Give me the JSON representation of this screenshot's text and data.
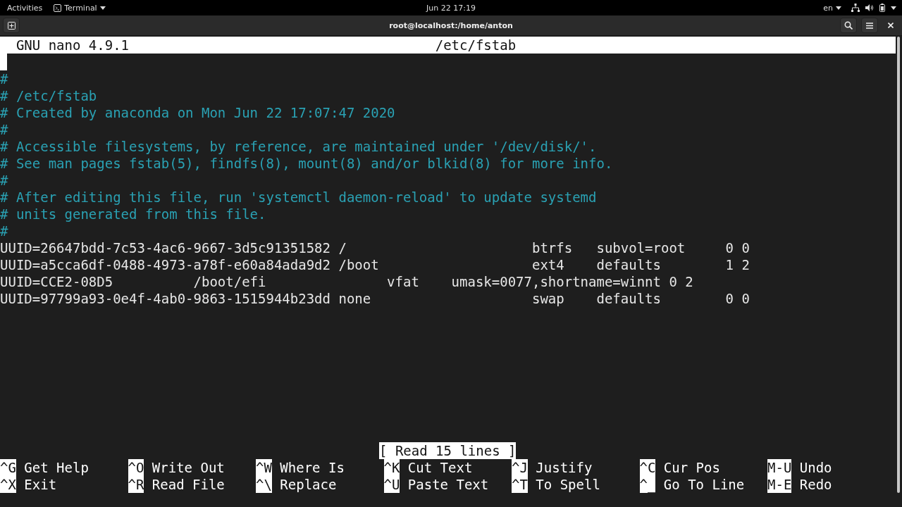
{
  "top_bar": {
    "activities": "Activities",
    "app_menu": {
      "label": "Terminal"
    },
    "clock": "Jun 22  17:19",
    "input_source": "en"
  },
  "window": {
    "title": "root@localhost:/home/anton"
  },
  "nano": {
    "header": {
      "version": "GNU nano 4.9.1",
      "filename": "/etc/fstab"
    },
    "lines": [
      {
        "kind": "blank",
        "cursor": true
      },
      {
        "kind": "comment",
        "text": "#",
        "cursor": false
      },
      {
        "kind": "comment",
        "text": "# /etc/fstab",
        "cursor": false
      },
      {
        "kind": "comment",
        "text": "# Created by anaconda on Mon Jun 22 17:07:47 2020",
        "cursor": false
      },
      {
        "kind": "comment",
        "text": "#",
        "cursor": false
      },
      {
        "kind": "comment",
        "text": "# Accessible filesystems, by reference, are maintained under '/dev/disk/'.",
        "cursor": false
      },
      {
        "kind": "comment",
        "text": "# See man pages fstab(5), findfs(8), mount(8) and/or blkid(8) for more info.",
        "cursor": false
      },
      {
        "kind": "comment",
        "text": "#",
        "cursor": false
      },
      {
        "kind": "comment",
        "text": "# After editing this file, run 'systemctl daemon-reload' to update systemd",
        "cursor": false
      },
      {
        "kind": "comment",
        "text": "# units generated from this file.",
        "cursor": false
      },
      {
        "kind": "comment",
        "text": "#",
        "cursor": false
      },
      {
        "kind": "config",
        "text": "UUID=26647bdd-7c53-4ac6-9667-3d5c91351582 /                       btrfs   subvol=root     0 0",
        "cursor": false
      },
      {
        "kind": "config",
        "text": "UUID=a5cca6df-0488-4973-a78f-e60a84ada9d2 /boot                   ext4    defaults        1 2",
        "cursor": false
      },
      {
        "kind": "config",
        "text": "UUID=CCE2-08D5          /boot/efi               vfat    umask=0077,shortname=winnt 0 2",
        "cursor": false
      },
      {
        "kind": "config",
        "text": "UUID=97799a93-0e4f-4ab0-9863-1515944b23dd none                    swap    defaults        0 0",
        "cursor": false
      }
    ],
    "status": "[ Read 15 lines ]",
    "shortcut_rows": [
      [
        {
          "key": "^G",
          "label": "Get Help"
        },
        {
          "key": "^O",
          "label": "Write Out"
        },
        {
          "key": "^W",
          "label": "Where Is"
        },
        {
          "key": "^K",
          "label": "Cut Text"
        },
        {
          "key": "^J",
          "label": "Justify"
        },
        {
          "key": "^C",
          "label": "Cur Pos"
        },
        {
          "key": "M-U",
          "label": "Undo"
        }
      ],
      [
        {
          "key": "^X",
          "label": "Exit"
        },
        {
          "key": "^R",
          "label": "Read File"
        },
        {
          "key": "^\\",
          "label": "Replace"
        },
        {
          "key": "^U",
          "label": "Paste Text"
        },
        {
          "key": "^T",
          "label": "To Spell"
        },
        {
          "key": "^_",
          "label": "Go To Line"
        },
        {
          "key": "M-E",
          "label": "Redo"
        }
      ]
    ]
  }
}
